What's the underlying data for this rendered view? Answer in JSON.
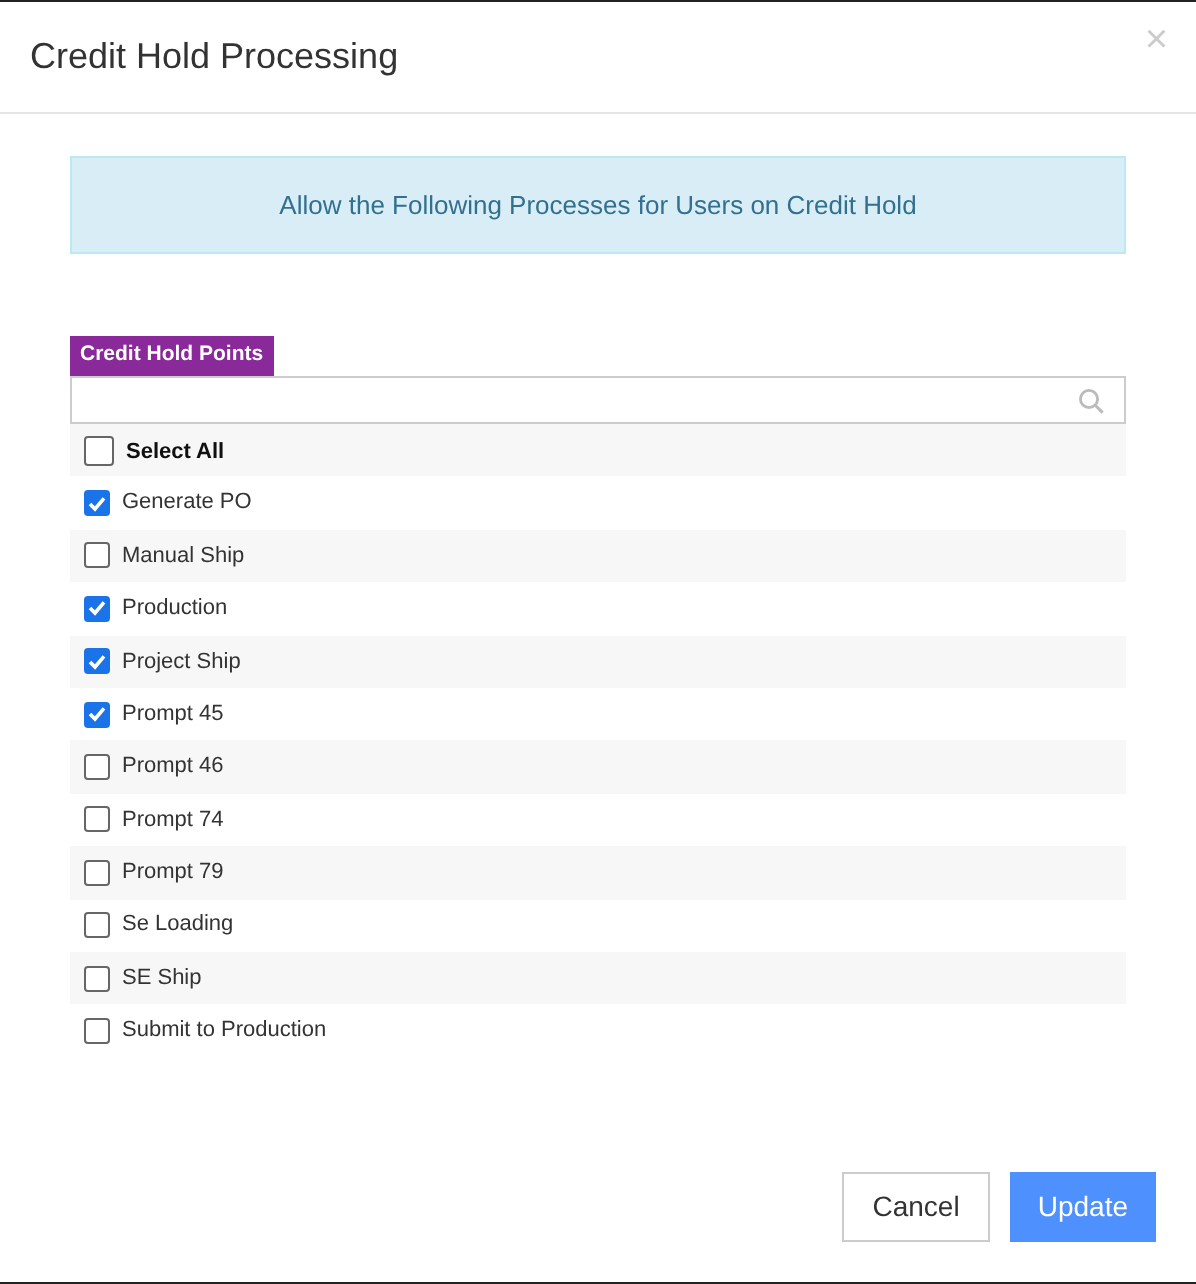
{
  "dialog": {
    "title": "Credit Hold Processing",
    "close": "×"
  },
  "alert": "Allow the Following Processes for Users on Credit Hold",
  "list": {
    "label": "Credit Hold Points",
    "select_all": {
      "label": "Select All",
      "checked": false
    },
    "items": [
      {
        "label": "Generate PO",
        "checked": true
      },
      {
        "label": "Manual Ship",
        "checked": false
      },
      {
        "label": "Production",
        "checked": true
      },
      {
        "label": "Project Ship",
        "checked": true
      },
      {
        "label": "Prompt 45",
        "checked": true
      },
      {
        "label": "Prompt 46",
        "checked": false
      },
      {
        "label": "Prompt 74",
        "checked": false
      },
      {
        "label": "Prompt 79",
        "checked": false
      },
      {
        "label": "Se Loading",
        "checked": false
      },
      {
        "label": "SE Ship",
        "checked": false
      },
      {
        "label": "Submit to Production",
        "checked": false
      }
    ]
  },
  "buttons": [
    {
      "label": "Cancel",
      "kind": "secondary"
    },
    {
      "label": "Update",
      "kind": "primary"
    }
  ]
}
